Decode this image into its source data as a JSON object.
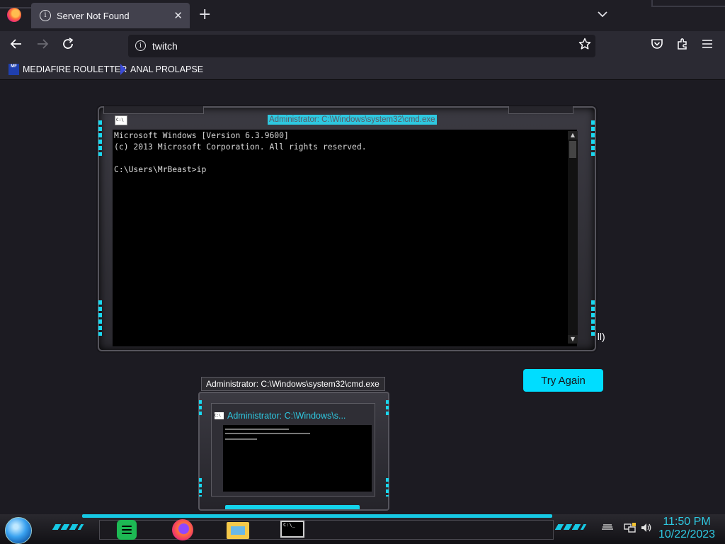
{
  "browser": {
    "tab_title": "Server Not Found",
    "new_tab_glyph": "+",
    "close_glyph": "✕",
    "url": "twitch",
    "bookmarks": [
      {
        "label": "MEDIAFIRE ROULETTER",
        "icon": "MF"
      },
      {
        "label": "ANAL PROLAPSE",
        "icon": "prolapse-favicon"
      }
    ]
  },
  "page": {
    "partial_text": "all)",
    "try_again_label": "Try Again"
  },
  "cmd": {
    "title": "Administrator: C:\\Windows\\system32\\cmd.exe",
    "icon_text": "C:\\",
    "lines": [
      "Microsoft Windows [Version 6.3.9600]",
      "(c) 2013 Microsoft Corporation. All rights reserved.",
      "",
      "C:\\Users\\MrBeast>ip"
    ]
  },
  "preview": {
    "title": "Administrator: C:\\Windows\\system32\\cmd.exe",
    "mini_title": "Administrator: C:\\Windows\\s..."
  },
  "taskbar": {
    "apps": [
      "spotify-icon",
      "firefox-icon",
      "file-explorer-icon",
      "cmd-icon"
    ],
    "cmd_icon_text": "C:\\_",
    "time": "11:50 PM",
    "date": "10/22/2023"
  },
  "colors": {
    "accent": "#19d8f0",
    "try_again_bg": "#00ddff",
    "clock": "#2ec8e0"
  }
}
